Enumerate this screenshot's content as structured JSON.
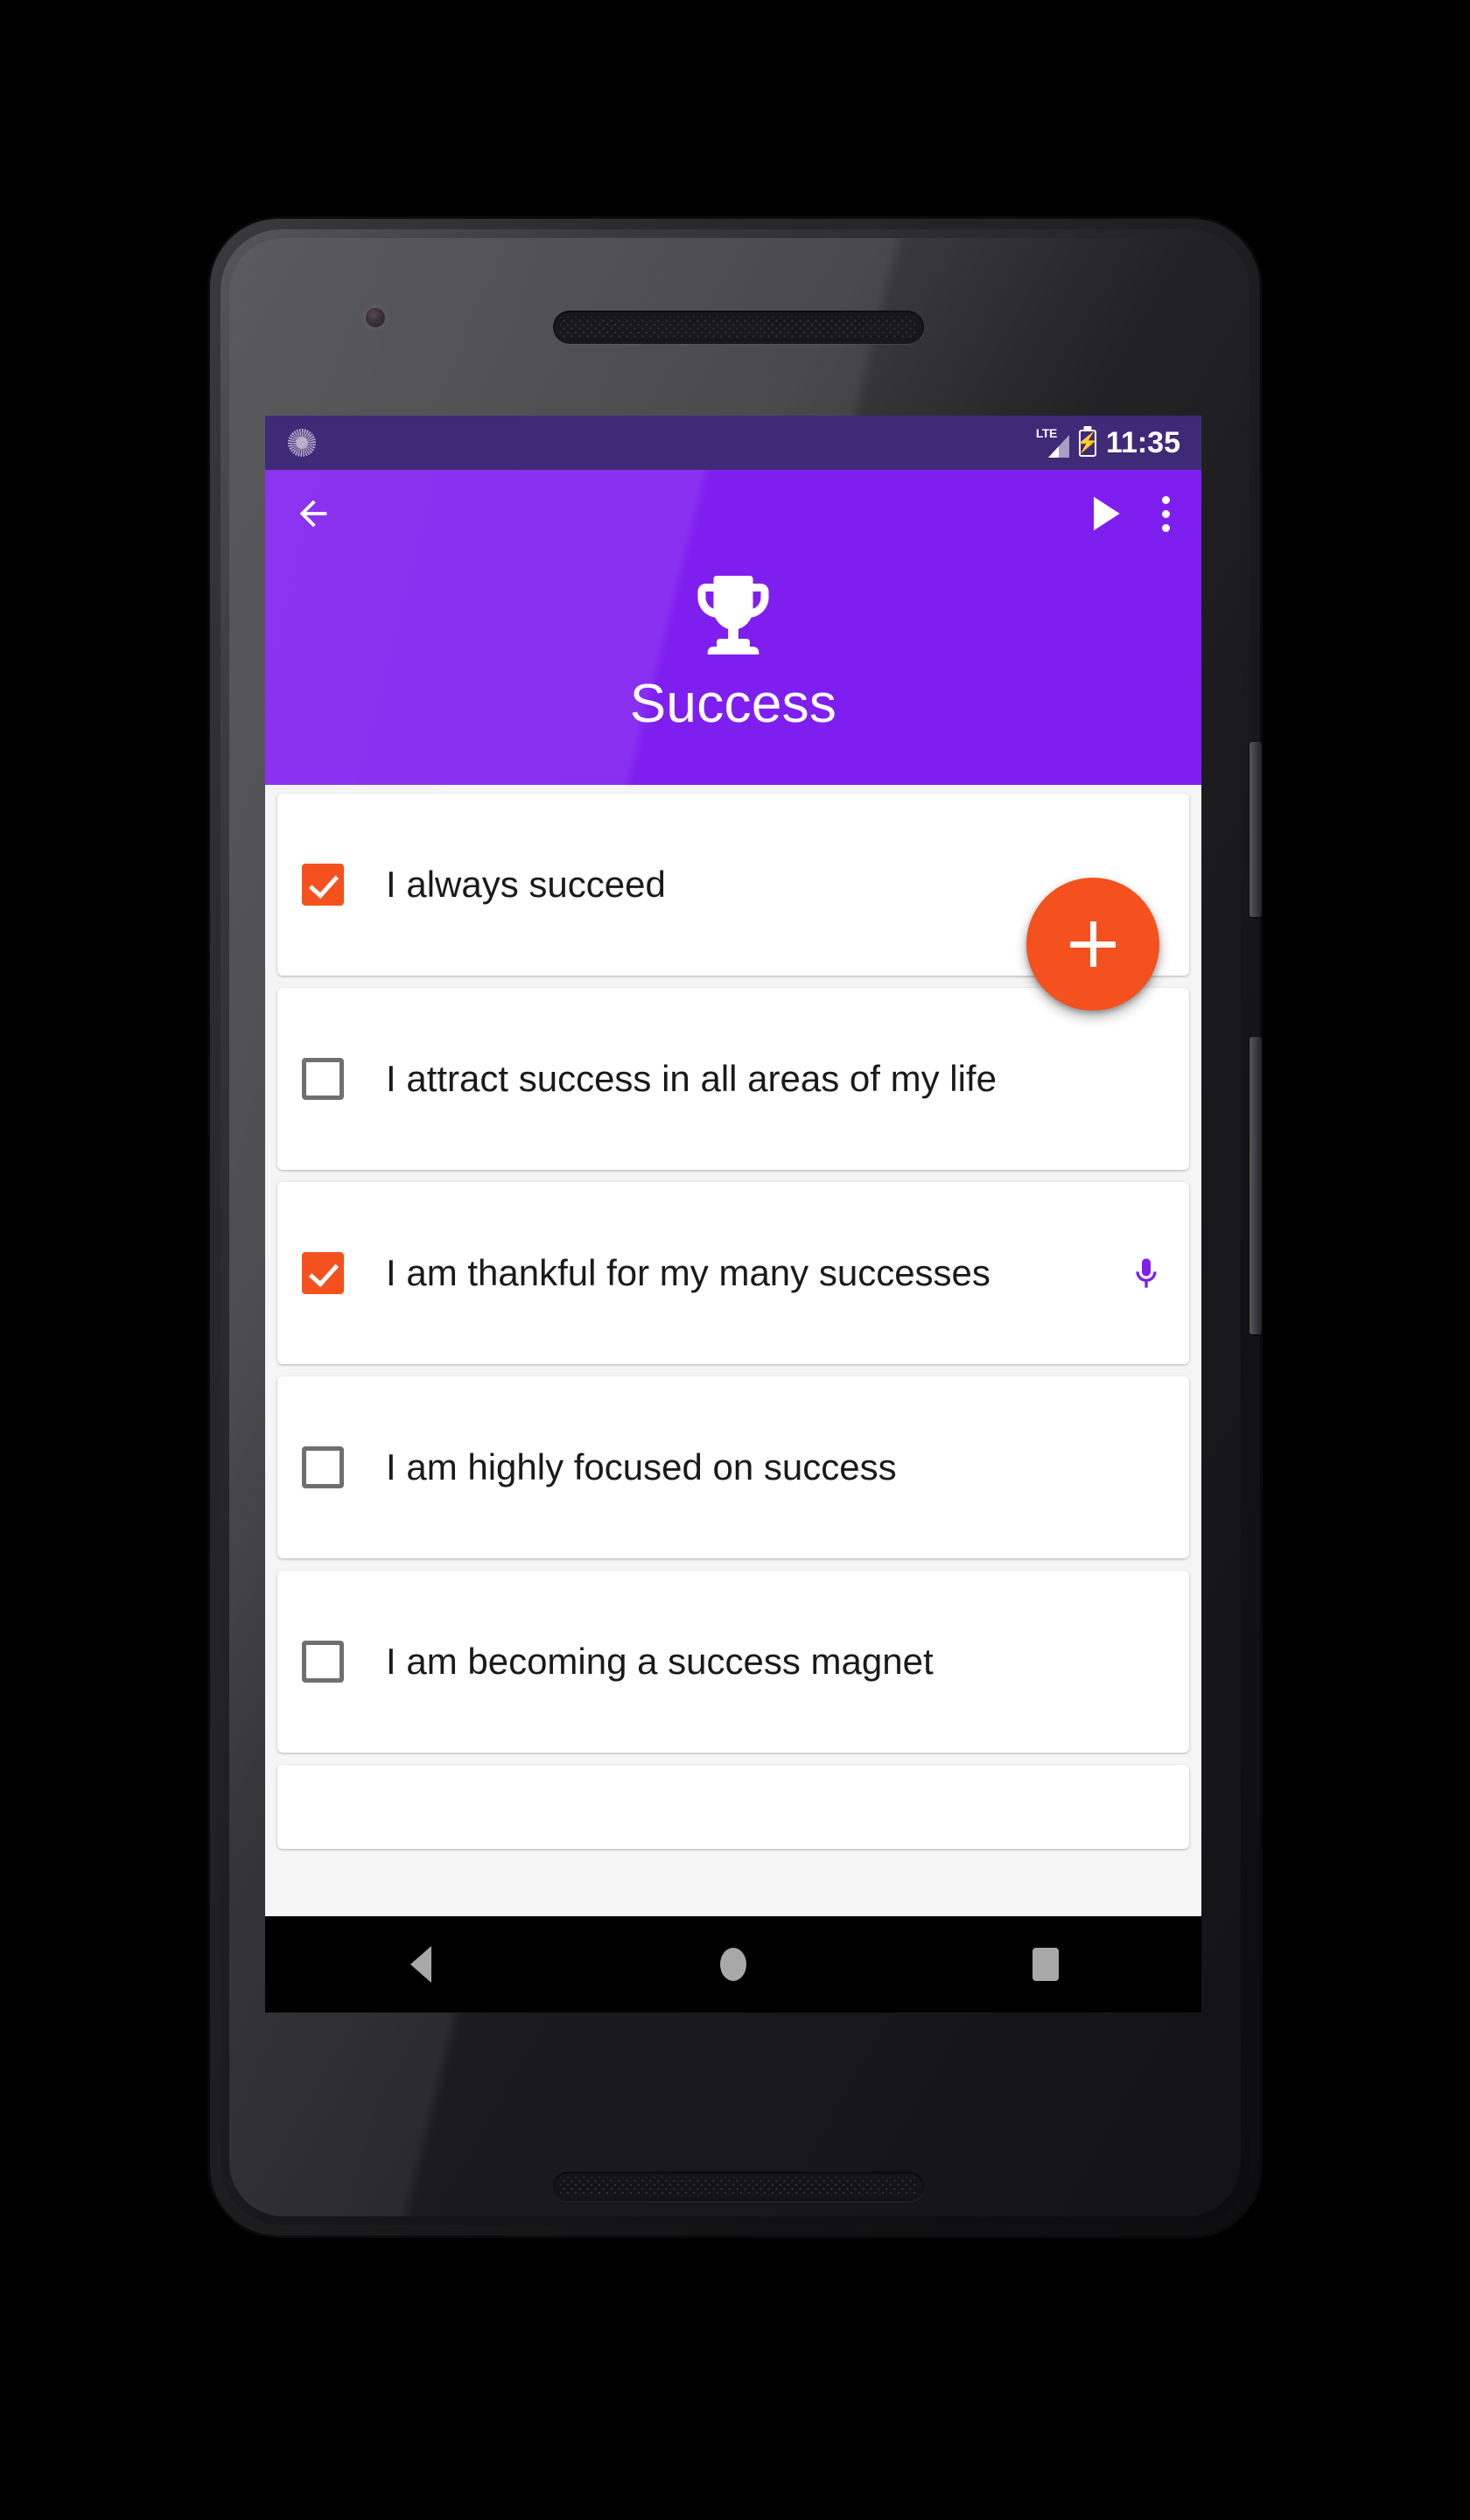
{
  "status_bar": {
    "notification_icon": "sun-circle-icon",
    "network_label": "LTE",
    "signal_icon": "signal-bars-icon",
    "battery_icon": "battery-charging-icon",
    "time": "11:35",
    "background_color": "#3F2A78"
  },
  "toolbar": {
    "back_icon": "arrow-left-icon",
    "play_icon": "play-icon",
    "overflow_icon": "more-vertical-icon"
  },
  "header": {
    "icon": "trophy-icon",
    "title": "Success",
    "background_color": "#7F1FEF"
  },
  "fab": {
    "icon": "plus-icon",
    "label": "+",
    "color": "#F4511E"
  },
  "list": {
    "items": [
      {
        "text": "I always succeed",
        "checked": true,
        "has_mic": false
      },
      {
        "text": "I attract success in all areas of my life",
        "checked": false,
        "has_mic": false
      },
      {
        "text": "I am thankful for my many successes",
        "checked": true,
        "has_mic": true,
        "mic_icon": "microphone-icon"
      },
      {
        "text": "I am highly focused on success",
        "checked": false,
        "has_mic": false
      },
      {
        "text": "I am becoming a success magnet",
        "checked": false,
        "has_mic": false
      }
    ],
    "checked_color": "#F4511E",
    "unchecked_color": "#707070",
    "mic_color": "#7F1FEF"
  },
  "nav_bar": {
    "back_icon": "triangle-back-icon",
    "home_icon": "circle-home-icon",
    "recents_icon": "square-recents-icon",
    "background_color": "#000000"
  },
  "device": {
    "camera_icon": "front-camera-icon",
    "earpiece_icon": "earpiece-speaker-icon",
    "bottom_speaker_icon": "bottom-speaker-icon",
    "power_button": "power-button",
    "volume_button": "volume-rocker-button"
  }
}
